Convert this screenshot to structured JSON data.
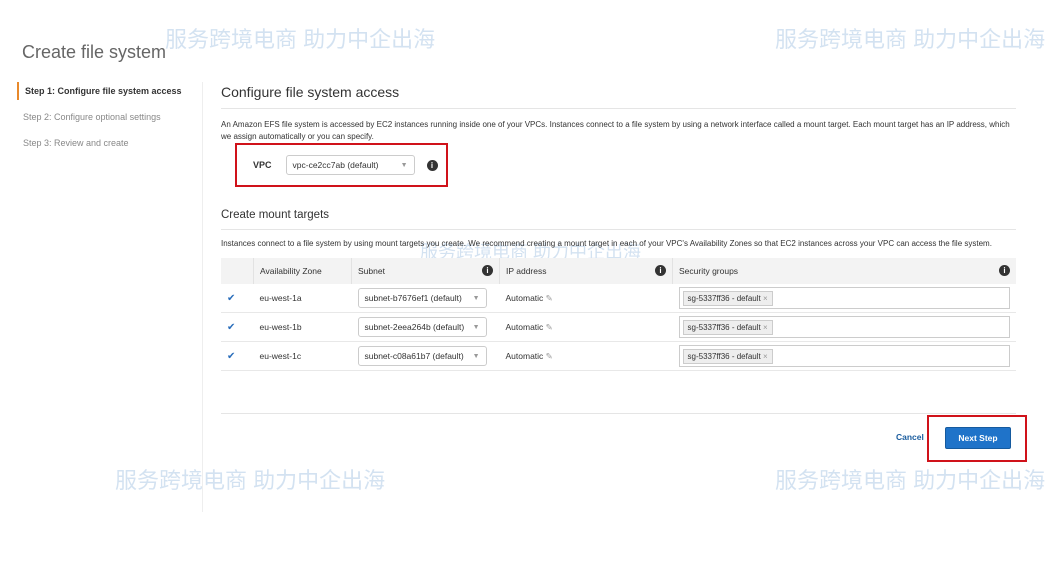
{
  "watermark": "服务跨境电商 助力中企出海",
  "page_title": "Create file system",
  "steps": [
    "Step 1: Configure file system access",
    "Step 2: Configure optional settings",
    "Step 3: Review and create"
  ],
  "section_title": "Configure file system access",
  "description": "An Amazon EFS file system is accessed by EC2 instances running inside one of your VPCs. Instances connect to a file system by using a network interface called a mount target. Each mount target has an IP address, which we assign automatically or you can specify.",
  "vpc": {
    "label": "VPC",
    "value": "vpc-ce2cc7ab (default)"
  },
  "mount": {
    "title": "Create mount targets",
    "description": "Instances connect to a file system by using mount targets you create. We recommend creating a mount target in each of your VPC's Availability Zones so that EC2 instances across your VPC can access the file system.",
    "headers": [
      "Availability Zone",
      "Subnet",
      "IP address",
      "Security groups"
    ],
    "rows": [
      {
        "az": "eu-west-1a",
        "subnet": "subnet-b7676ef1 (default)",
        "ip": "Automatic",
        "sg": "sg-5337ff36 - default"
      },
      {
        "az": "eu-west-1b",
        "subnet": "subnet-2eea264b (default)",
        "ip": "Automatic",
        "sg": "sg-5337ff36 - default"
      },
      {
        "az": "eu-west-1c",
        "subnet": "subnet-c08a61b7 (default)",
        "ip": "Automatic",
        "sg": "sg-5337ff36 - default"
      }
    ]
  },
  "buttons": {
    "cancel": "Cancel",
    "next": "Next Step"
  }
}
